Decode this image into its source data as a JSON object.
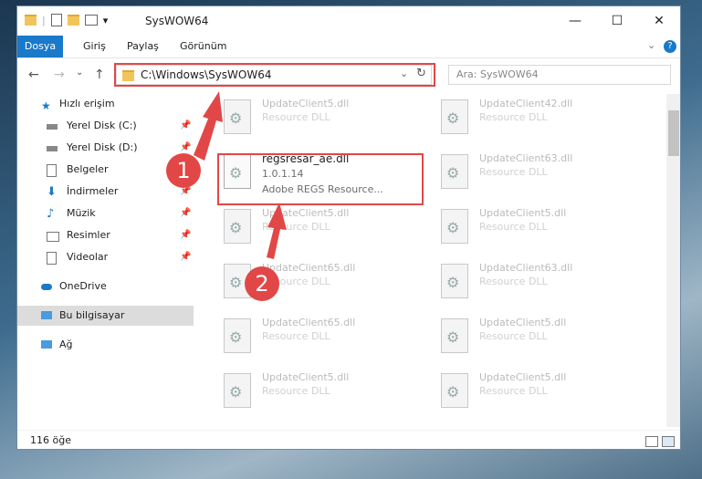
{
  "window": {
    "title": "SysWOW64",
    "qat_dropdown": "▾",
    "minimize": "—",
    "maximize": "☐",
    "close": "✕"
  },
  "ribbon": {
    "tabs": [
      "Dosya",
      "Giriş",
      "Paylaş",
      "Görünüm"
    ],
    "expand": "⌄",
    "help": "?"
  },
  "navigation": {
    "back": "←",
    "forward": "→",
    "recent": "⌄",
    "up": "↑",
    "address": "C:\\Windows\\SysWOW64",
    "address_dropdown": "⌄",
    "refresh": "↻",
    "search_placeholder": "Ara: SysWOW64"
  },
  "sidebar": {
    "quick_access": "Hızlı erişim",
    "items": [
      {
        "label": "Yerel Disk (C:)",
        "pinned": true
      },
      {
        "label": "Yerel Disk (D:)",
        "pinned": true
      },
      {
        "label": "Belgeler",
        "pinned": true
      },
      {
        "label": "İndirmeler",
        "pinned": true
      },
      {
        "label": "Müzik",
        "pinned": true
      },
      {
        "label": "Resimler",
        "pinned": true
      },
      {
        "label": "Videolar",
        "pinned": true
      }
    ],
    "pin_glyph": "📌",
    "onedrive": "OneDrive",
    "this_pc": "Bu bilgisayar",
    "network": "Ağ"
  },
  "files": {
    "left": [
      {
        "name": "UpdateClient5.dll",
        "desc": "Resource DLL"
      },
      {
        "name": "regsresar_ae.dll",
        "version": "1.0.1.14",
        "desc": "Adobe REGS Resource..."
      },
      {
        "name": "UpdateClient5.dll",
        "desc": "Resource DLL"
      },
      {
        "name": "UpdateClient65.dll",
        "desc": "Resource DLL"
      },
      {
        "name": "UpdateClient65.dll",
        "desc": "Resource DLL"
      },
      {
        "name": "UpdateClient5.dll",
        "desc": "Resource DLL"
      }
    ],
    "right": [
      {
        "name": "UpdateClient42.dll",
        "desc": "Resource DLL"
      },
      {
        "name": "UpdateClient63.dll",
        "desc": "Resource DLL"
      },
      {
        "name": "UpdateClient5.dll",
        "desc": "Resource DLL"
      },
      {
        "name": "UpdateClient63.dll",
        "desc": "Resource DLL"
      },
      {
        "name": "UpdateClient5.dll",
        "desc": "Resource DLL"
      },
      {
        "name": "UpdateClient5.dll",
        "desc": "Resource DLL"
      }
    ]
  },
  "status": {
    "count": "116 öğe"
  },
  "callouts": {
    "one": "1",
    "two": "2"
  },
  "colors": {
    "accent": "#1979ca",
    "highlight": "#e24747"
  }
}
